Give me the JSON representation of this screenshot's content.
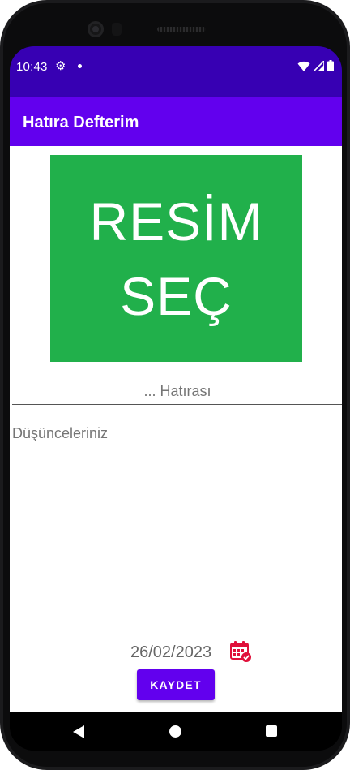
{
  "status_bar": {
    "time": "10:43",
    "icons": [
      "settings-gear-icon",
      "notification-dot-icon",
      "wifi-icon",
      "signal-icon",
      "battery-icon"
    ]
  },
  "app_bar": {
    "title": "Hatıra Defterim"
  },
  "image_picker": {
    "line1": "RESİM",
    "line2": "SEÇ",
    "background": "#21b04b"
  },
  "form": {
    "title_placeholder": "... Hatırası",
    "memo_placeholder": "Düşünceleriniz",
    "date": "26/02/2023",
    "date_icon": "calendar-icon",
    "save_label": "KAYDET"
  },
  "nav_bar": {
    "icons": [
      "back-icon",
      "home-icon",
      "recents-icon"
    ]
  },
  "colors": {
    "status_bar": "#3700b3",
    "app_bar": "#6200ee",
    "accent": "#6200ee",
    "calendar": "#e0103a"
  }
}
